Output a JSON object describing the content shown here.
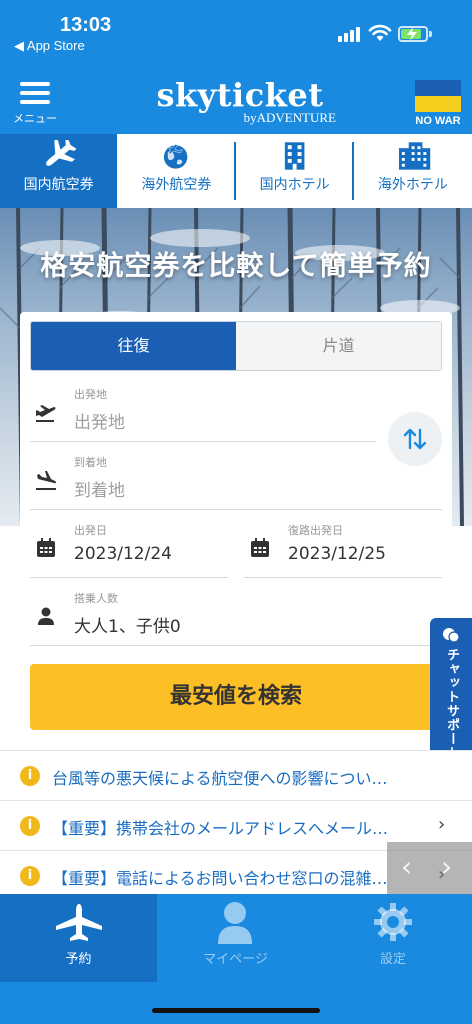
{
  "status": {
    "time": "13:03",
    "back": "◀ App Store"
  },
  "header": {
    "menu_label": "メニュー",
    "logo": "skyticket",
    "logo_sub": "byADVENTURE",
    "nowar": "NO WAR"
  },
  "tabs": [
    {
      "label": "国内航空券",
      "icon": "airplane-icon"
    },
    {
      "label": "海外航空券",
      "icon": "globe-airplane-icon"
    },
    {
      "label": "国内ホテル",
      "icon": "building-icon"
    },
    {
      "label": "海外ホテル",
      "icon": "buildings-icon"
    }
  ],
  "hero": {
    "title": "格安航空券を比較して簡単予約"
  },
  "search": {
    "trip_round": "往復",
    "trip_oneway": "片道",
    "origin_label": "出発地",
    "origin_placeholder": "出発地",
    "dest_label": "到着地",
    "dest_placeholder": "到着地",
    "depart_label": "出発日",
    "depart_value": "2023/12/24",
    "return_label": "復路出発日",
    "return_value": "2023/12/25",
    "pax_label": "搭乗人数",
    "pax_value": "大人1、子供0",
    "button": "最安値を検索"
  },
  "chat": {
    "label": "チャットサポート"
  },
  "news": [
    {
      "text": "台風等の悪天候による航空便への影響につい…"
    },
    {
      "text": "【重要】携帯会社のメールアドレスへメール…"
    },
    {
      "text": "【重要】電話によるお問い合わせ窓口の混雑…"
    }
  ],
  "bottom_nav": [
    {
      "label": "予約"
    },
    {
      "label": "マイページ"
    },
    {
      "label": "設定"
    }
  ],
  "colors": {
    "primary": "#1a8ae0",
    "dark": "#1570c4",
    "accent": "#fdbf26"
  }
}
